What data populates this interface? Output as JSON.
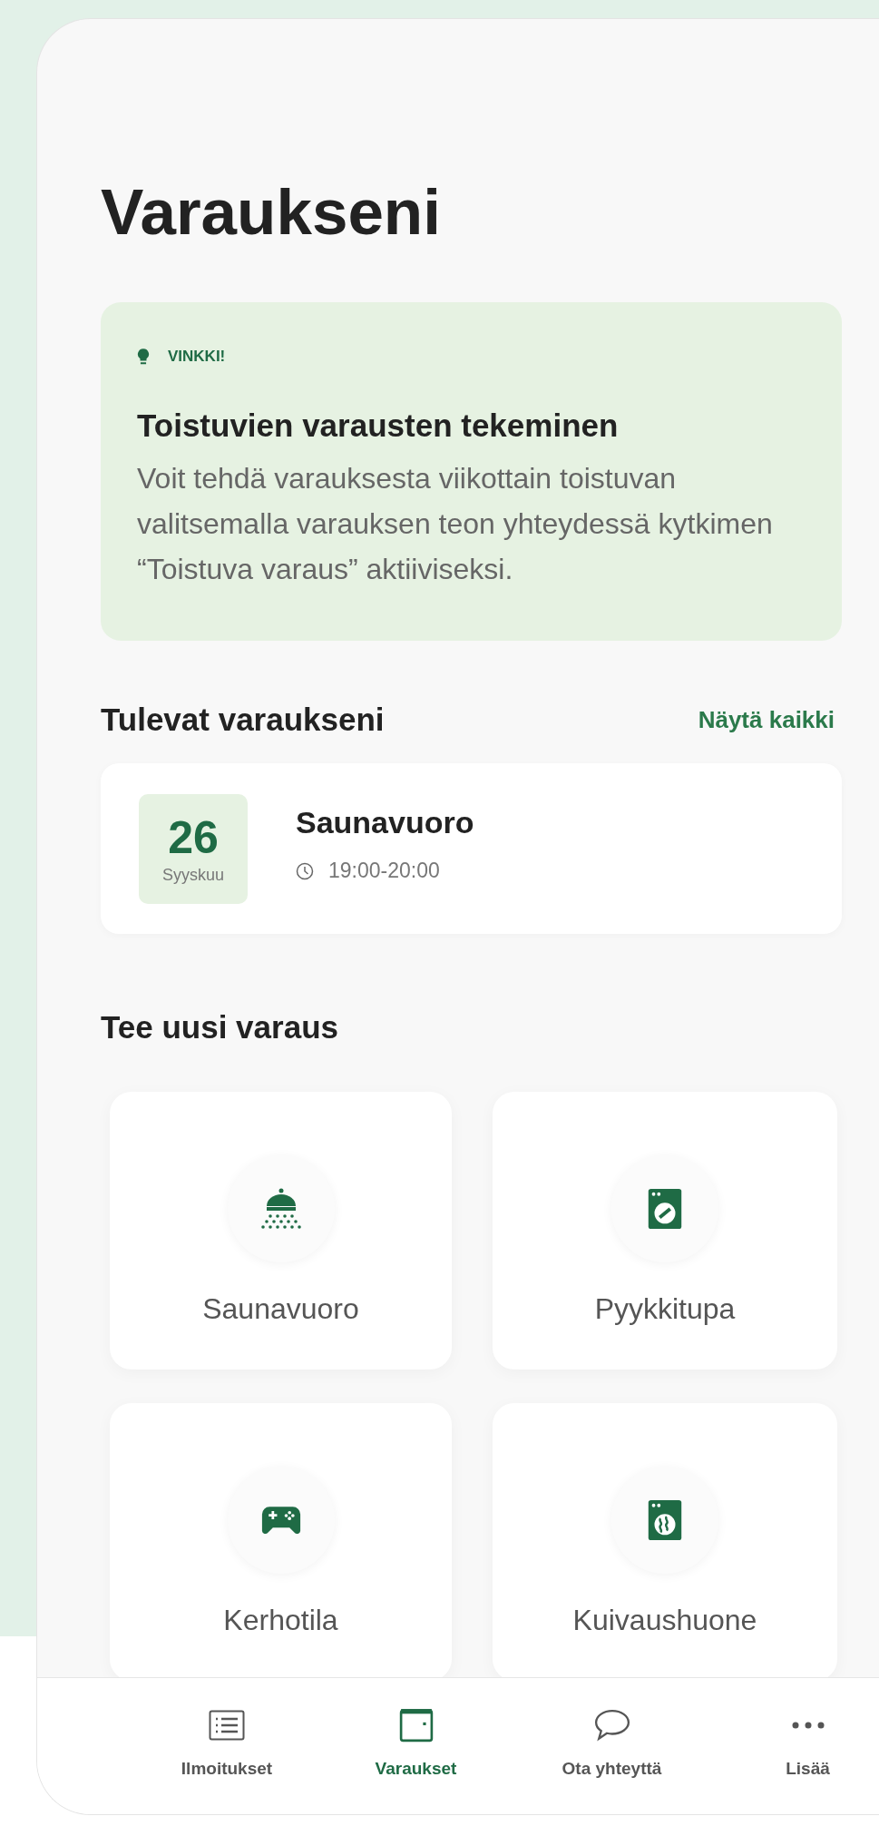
{
  "page": {
    "title": "Varaukseni"
  },
  "tip": {
    "badge": "VINKKI!",
    "title": "Toistuvien varausten tekeminen",
    "body": "Voit tehdä varauksesta viikottain toistuvan valitsemalla varauksen teon yhteydessä kytkimen “Toistuva varaus” aktiiviseksi."
  },
  "upcoming": {
    "heading": "Tulevat varaukseni",
    "link": "Näytä kaikki",
    "bookings": [
      {
        "day": "26",
        "month": "Syyskuu",
        "title": "Saunavuoro",
        "time": "19:00-20:00"
      }
    ]
  },
  "new_booking": {
    "heading": "Tee uusi varaus",
    "spaces": [
      {
        "kind": "sauna",
        "label": "Saunavuoro"
      },
      {
        "kind": "laundry",
        "label": "Pyykkitupa"
      },
      {
        "kind": "clubroom",
        "label": "Kerhotila"
      },
      {
        "kind": "drying",
        "label": "Kuivaushuone"
      }
    ]
  },
  "nav": [
    {
      "kind": "list",
      "label": "Ilmoitukset",
      "selected": false
    },
    {
      "kind": "calendar",
      "label": "Varaukset",
      "selected": true
    },
    {
      "kind": "chat",
      "label": "Ota yhteyttä",
      "selected": false
    },
    {
      "kind": "more",
      "label": "Lisää",
      "selected": false
    }
  ]
}
